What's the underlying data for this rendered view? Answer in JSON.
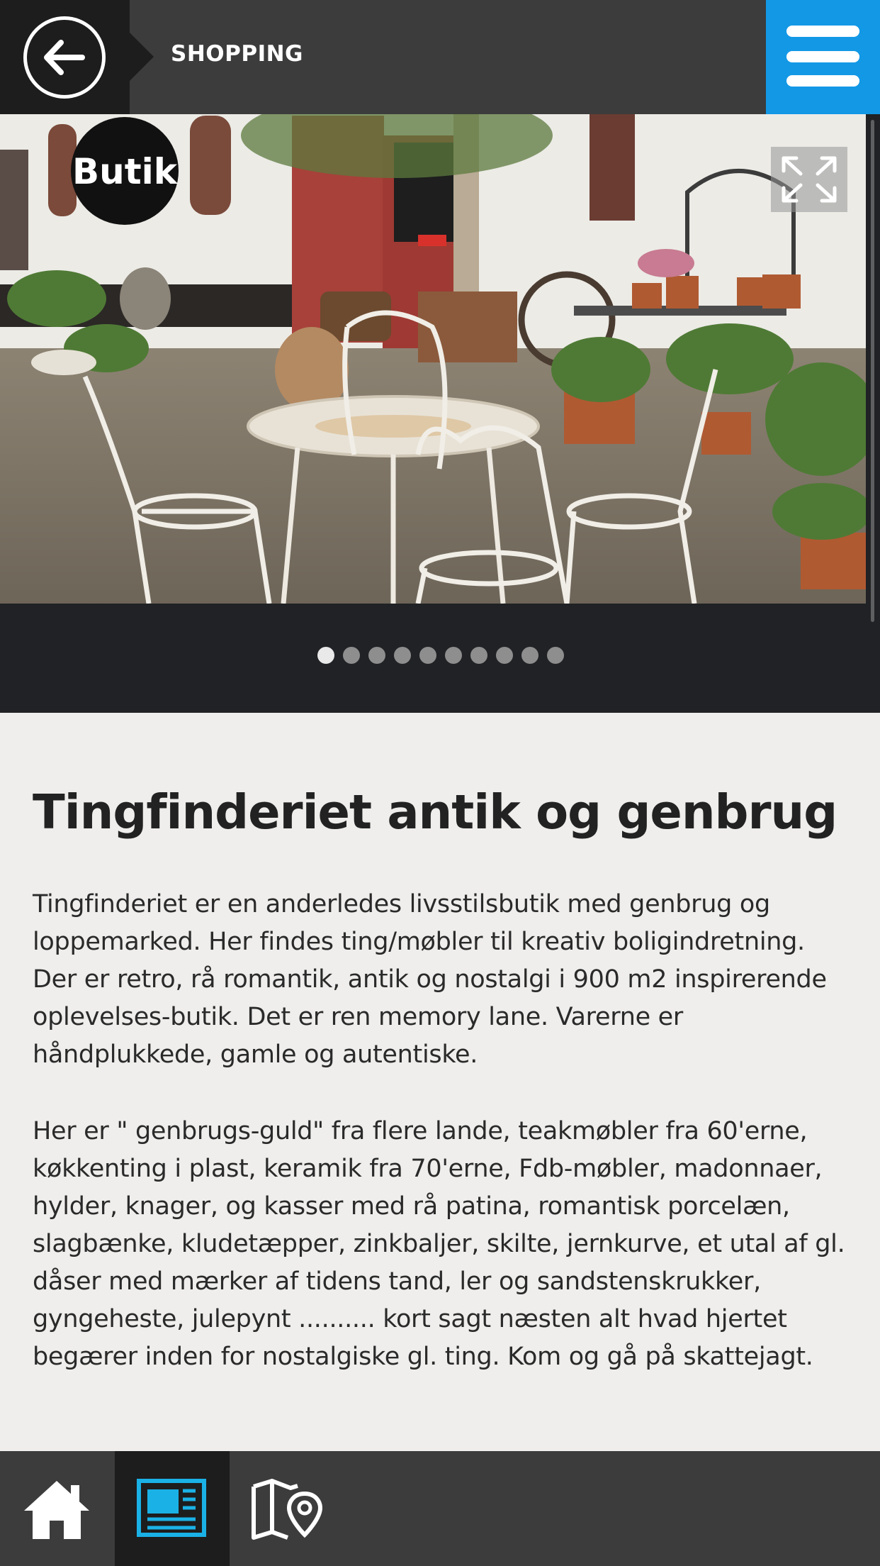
{
  "header": {
    "back_icon": "arrow-left-icon",
    "title": "SHOPPING",
    "menu_icon": "hamburger-menu-icon",
    "menu_color": "#1398e6"
  },
  "gallery": {
    "image_alt": "Tingfinderiet butik med hvide havemøbler",
    "sign_text": "Butik",
    "expand_icon": "expand-icon",
    "dot_count": 10,
    "active_dot": 0
  },
  "article": {
    "title": "Tingfinderiet antik og genbrug",
    "paragraphs": [
      "Tingfinderiet er en anderledes livsstilsbutik med genbrug og loppemarked. Her findes ting/møbler til kreativ boligindretning. Der er retro, rå romantik, antik og nostalgi i 900 m2 inspirerende oplevelses-butik. Det er ren memory lane. Varerne er håndplukkede, gamle og autentiske.",
      "Her er \" genbrugs-guld\" fra flere lande, teakmøbler fra 60'erne, køkkenting i plast, keramik fra 70'erne, Fdb-møbler, madonnaer, hylder, knager, og kasser med rå patina, romantisk porcelæn, slagbænke, kludetæpper, zinkbaljer, skilte, jernkurve, et utal af gl. dåser med mærker af tidens tand, ler og sandstenskrukker, gyngeheste, julepynt .......... kort sagt næsten alt hvad hjertet begærer inden for nostalgiske gl. ting. Kom og gå på skattejagt."
    ]
  },
  "bottom_nav": {
    "items": [
      {
        "icon": "home-icon",
        "active": false
      },
      {
        "icon": "article-icon",
        "active": true,
        "color": "#1ab1e6"
      },
      {
        "icon": "map-pin-icon",
        "active": false
      }
    ]
  }
}
